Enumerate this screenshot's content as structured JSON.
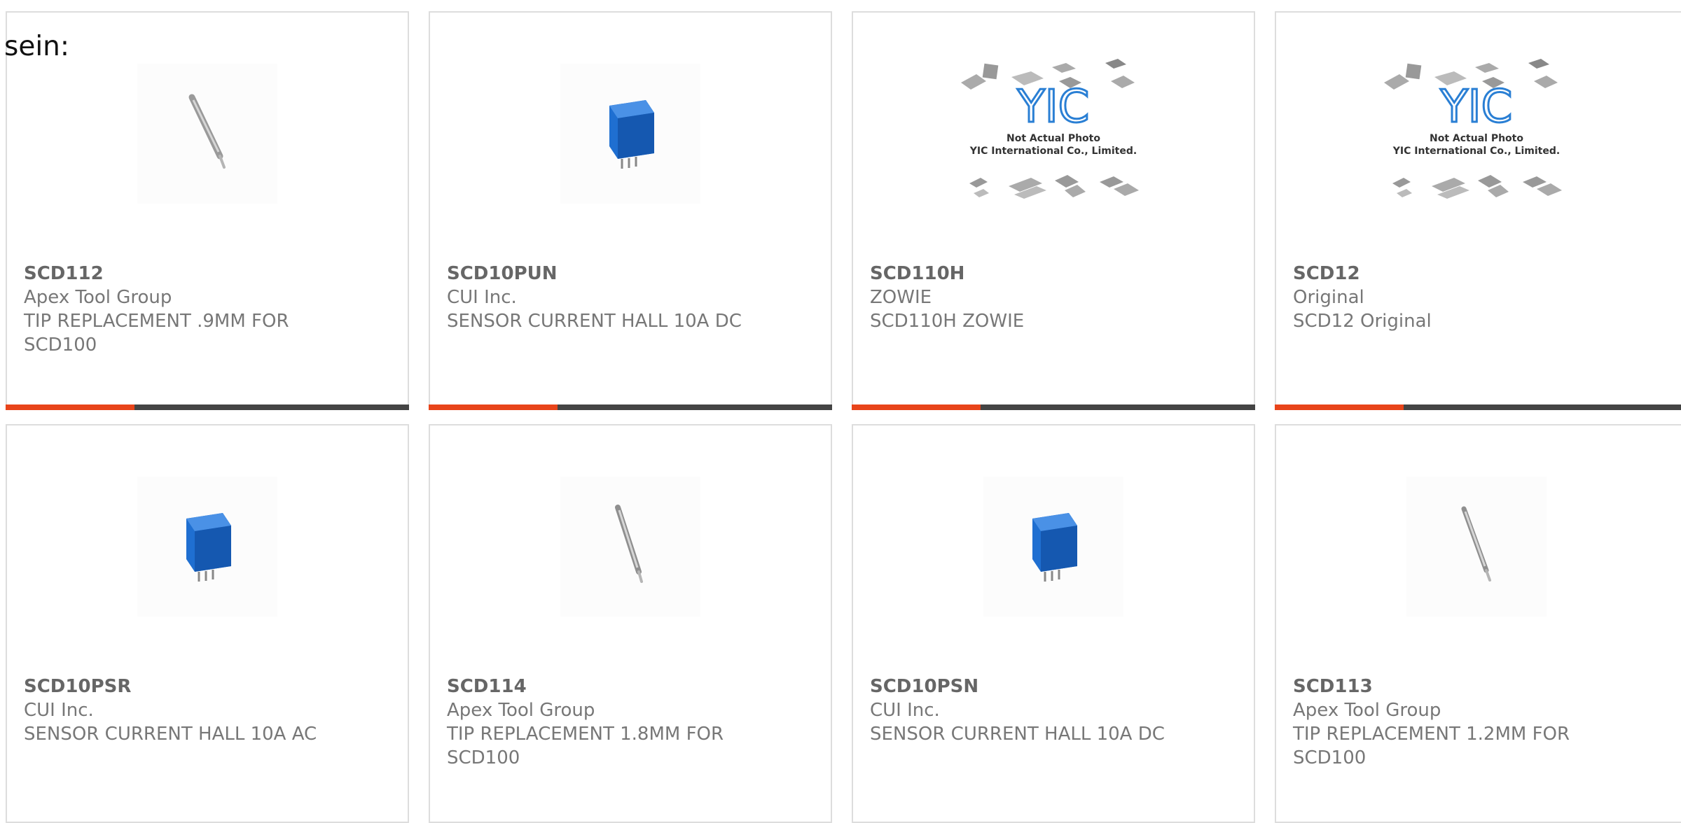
{
  "intro_text": "sein:",
  "products": [
    {
      "sku": "SCD112",
      "maker": "Apex Tool Group",
      "desc": "TIP REPLACEMENT .9MM FOR SCD100",
      "image": "tip-icon"
    },
    {
      "sku": "SCD10PUN",
      "maker": "CUI Inc.",
      "desc": "SENSOR CURRENT HALL 10A DC",
      "image": "sensor-icon"
    },
    {
      "sku": "SCD110H",
      "maker": "ZOWIE",
      "desc": "SCD110H ZOWIE",
      "image": "yic-placeholder"
    },
    {
      "sku": "SCD12",
      "maker": "Original",
      "desc": "SCD12 Original",
      "image": "yic-placeholder"
    },
    {
      "sku": "SCD10PSR",
      "maker": "CUI Inc.",
      "desc": "SENSOR CURRENT HALL 10A AC",
      "image": "sensor-icon"
    },
    {
      "sku": "SCD114",
      "maker": "Apex Tool Group",
      "desc": "TIP REPLACEMENT 1.8MM FOR SCD100",
      "image": "tip-icon"
    },
    {
      "sku": "SCD10PSN",
      "maker": "CUI Inc.",
      "desc": "SENSOR CURRENT HALL 10A DC",
      "image": "sensor-icon"
    },
    {
      "sku": "SCD113",
      "maker": "Apex Tool Group",
      "desc": "TIP REPLACEMENT 1.2MM FOR SCD100",
      "image": "tip-icon"
    }
  ],
  "placeholder": {
    "logo": "YIC",
    "line1": "Not Actual Photo",
    "line2": "YIC International Co., Limited."
  },
  "colors": {
    "accent": "#e8441a",
    "bar": "#444444",
    "sensor_blue": "#1f6fd1",
    "logo_blue": "#2a7fd4"
  }
}
